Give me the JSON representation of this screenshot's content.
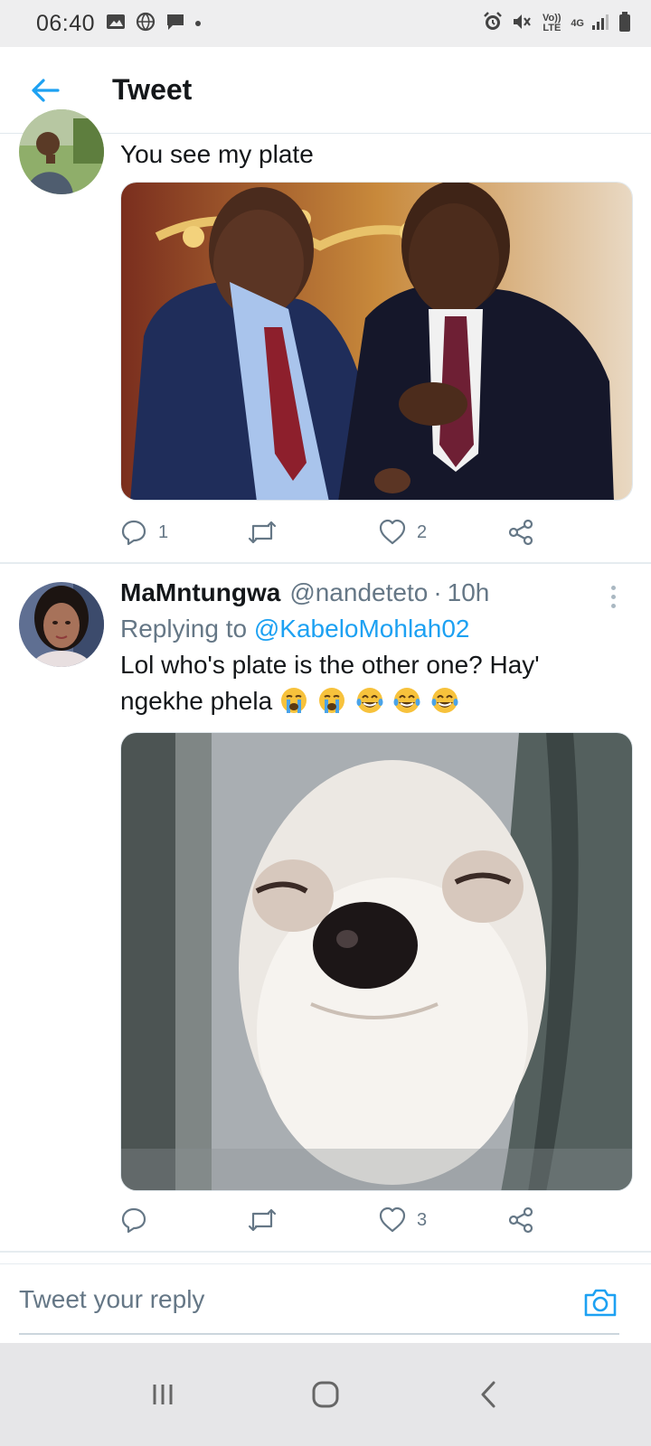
{
  "status_bar": {
    "time": "06:40",
    "volte_label": "Vo)) LTE",
    "network_label": "4G"
  },
  "header": {
    "title": "Tweet"
  },
  "tweets": [
    {
      "text": "You see my plate",
      "actions": {
        "reply_count": "1",
        "retweet_count": "",
        "like_count": "2"
      }
    },
    {
      "display_name": "MaMntungwa",
      "handle": "@nandeteto",
      "time": "10h",
      "replying_prefix": "Replying to",
      "replying_to": "@KabeloMohlah02",
      "text_line1": "Lol who's plate is the other one? Hay'",
      "text_line2": "ngekhe phela",
      "emojis": [
        "crying-face",
        "crying-face",
        "tears-of-joy-face",
        "tears-of-joy-face",
        "tears-of-joy-face"
      ],
      "actions": {
        "reply_count": "",
        "retweet_count": "",
        "like_count": "3"
      }
    }
  ],
  "reply_bar": {
    "placeholder": "Tweet your reply"
  },
  "colors": {
    "accent": "#1da1f2",
    "secondary_text": "#657786",
    "divider": "#e6ecf0"
  }
}
